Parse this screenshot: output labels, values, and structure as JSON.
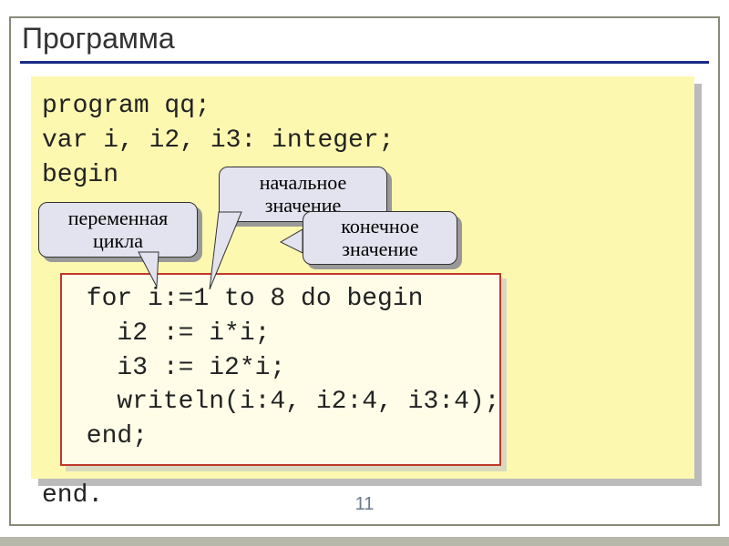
{
  "title": "Программа",
  "code": {
    "l1": "program qq;",
    "l2": "var i, i2, i3: integer;",
    "l3": "begin",
    "for": {
      "l1": " for i:=1 to 8 do begin",
      "l2": "   i2 := i*i;",
      "l3": "   i3 := i2*i;",
      "l4": "   writeln(i:4, i2:4, i3:4);",
      "l5": " end;"
    },
    "lend": "end."
  },
  "callouts": {
    "loopvar": "переменная цикла",
    "initval": "начальное значение",
    "finalval": "конечное значение"
  },
  "page": "11"
}
